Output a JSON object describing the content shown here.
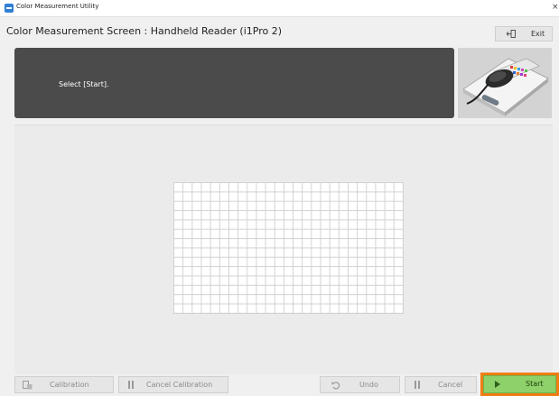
{
  "window": {
    "title": "Color Measurement Utility",
    "close_glyph": "×"
  },
  "header": {
    "title": "Color Measurement Screen : Handheld Reader (i1Pro 2)",
    "exit_label": "Exit",
    "exit_icon": "exit-door-icon"
  },
  "instruction": {
    "text": "Select [Start].",
    "image": "handheld-reader-device-image"
  },
  "measurement": {
    "grid_columns": 25,
    "grid_rows": 14
  },
  "toolbar": {
    "calibration_label": "Calibration",
    "calibration_icon": "calibration-icon",
    "cancel_calibration_label": "Cancel Calibration",
    "cancel_calibration_icon": "pause-icon",
    "undo_label": "Undo",
    "undo_icon": "undo-icon",
    "cancel_label": "Cancel",
    "cancel_icon": "pause-icon",
    "start_label": "Start",
    "start_icon": "play-icon"
  },
  "colors": {
    "instruction_panel": "#4b4b4b",
    "start_button": "#8ed16a",
    "start_highlight": "#ef7d13",
    "app_icon": "#2f7fd6"
  }
}
